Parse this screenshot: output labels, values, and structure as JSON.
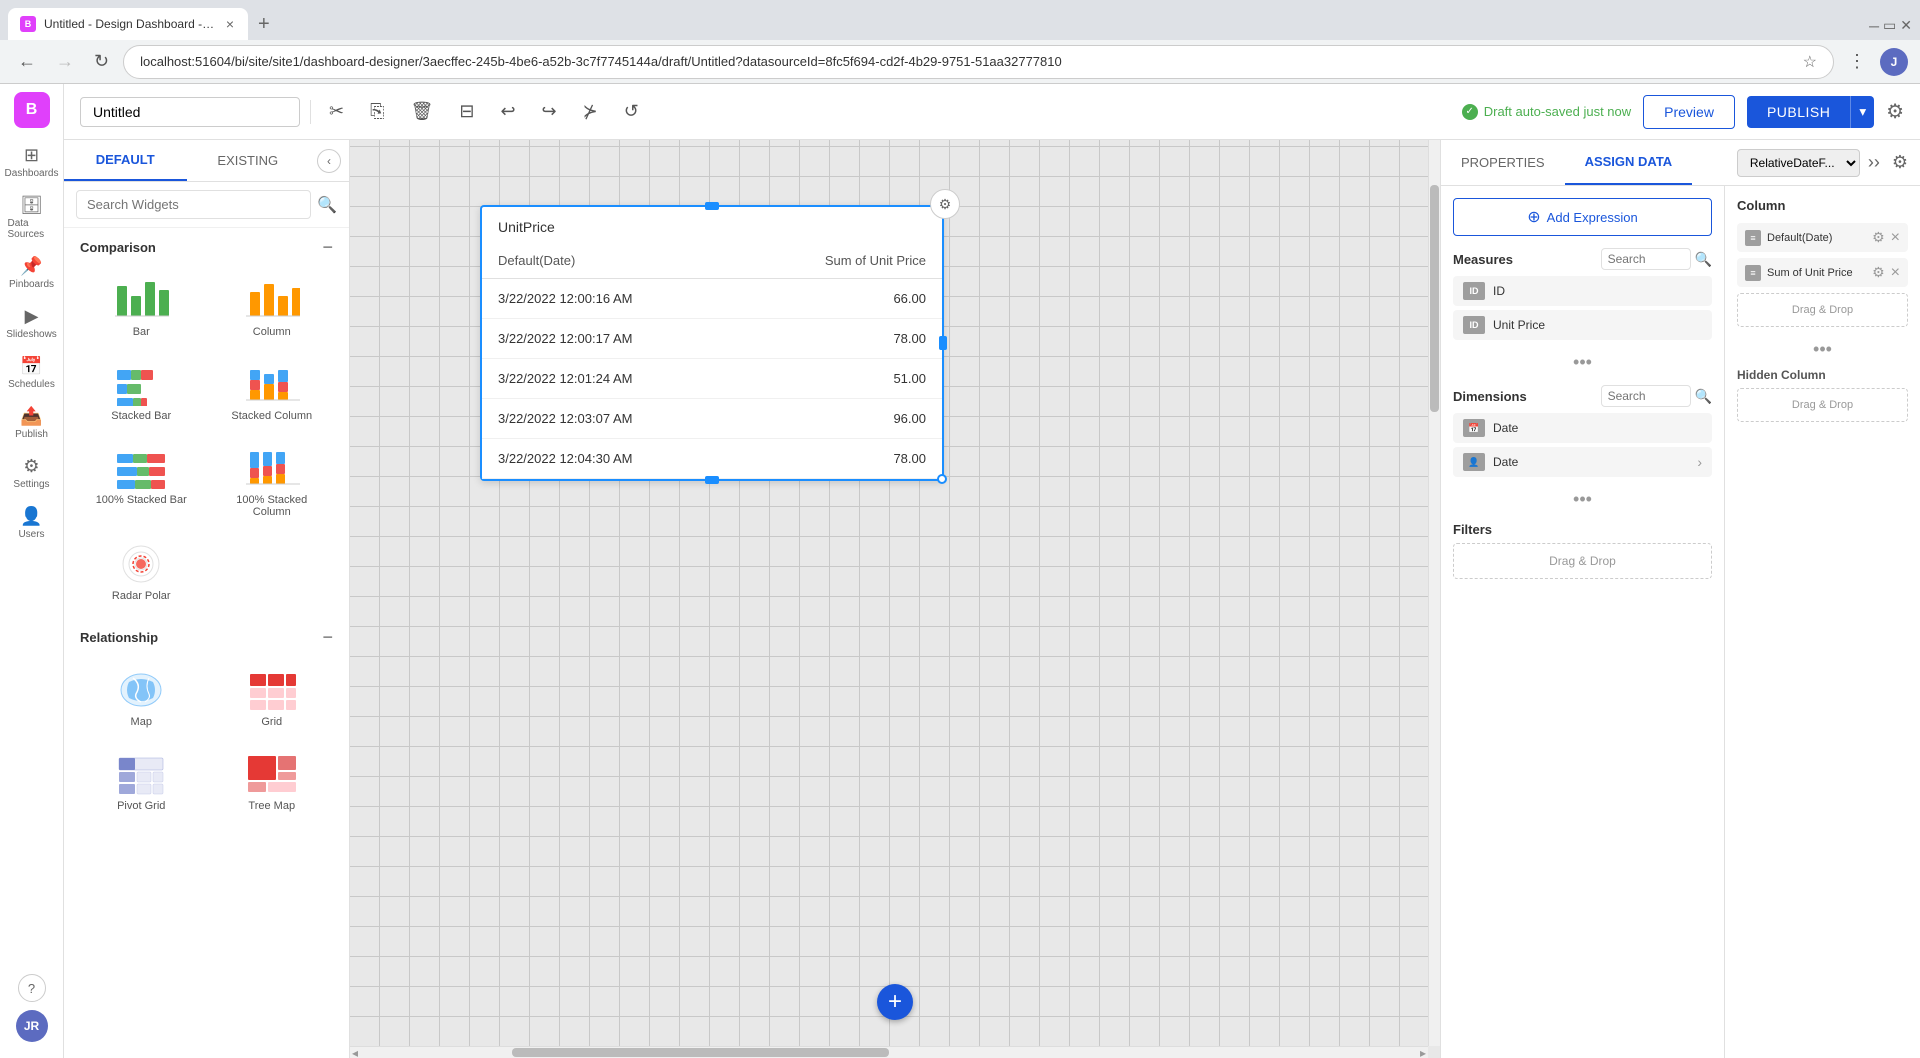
{
  "browser": {
    "tab_title": "Untitled - Design Dashboard - B...",
    "url": "localhost:51604/bi/site/site1/dashboard-designer/3aecffec-245b-4be6-a52b-3c7f7745144a/draft/Untitled?datasourceId=8fc5f694-cd2f-4b29-9751-51aa32777810",
    "new_tab_label": "+"
  },
  "toolbar": {
    "title": "Untitled",
    "auto_saved": "Draft auto-saved just now",
    "preview_label": "Preview",
    "publish_label": "PUBLISH"
  },
  "sidebar": {
    "logo": "B",
    "items": [
      {
        "id": "dashboards",
        "label": "Dashboards",
        "icon": "⊞"
      },
      {
        "id": "data-sources",
        "label": "Data Sources",
        "icon": "🗄"
      },
      {
        "id": "pinboards",
        "label": "Pinboards",
        "icon": "📌"
      },
      {
        "id": "slideshows",
        "label": "Slideshows",
        "icon": "▶"
      },
      {
        "id": "schedules",
        "label": "Schedules",
        "icon": "📅"
      },
      {
        "id": "publish",
        "label": "Publish",
        "icon": "📤"
      },
      {
        "id": "settings",
        "label": "Settings",
        "icon": "⚙"
      },
      {
        "id": "users",
        "label": "Users",
        "icon": "👤"
      }
    ],
    "user_initials": "JR",
    "help_icon": "?"
  },
  "widget_panel": {
    "tabs": [
      "DEFAULT",
      "EXISTING"
    ],
    "search_placeholder": "Search Widgets",
    "sections": {
      "comparison": {
        "title": "Comparison",
        "widgets": [
          {
            "id": "bar",
            "label": "Bar"
          },
          {
            "id": "column",
            "label": "Column"
          },
          {
            "id": "stacked-bar",
            "label": "Stacked Bar"
          },
          {
            "id": "stacked-column",
            "label": "Stacked Column"
          },
          {
            "id": "100-stacked-bar",
            "label": "100% Stacked Bar"
          },
          {
            "id": "100-stacked-column",
            "label": "100% Stacked Column"
          },
          {
            "id": "radar-polar",
            "label": "Radar Polar"
          }
        ]
      },
      "relationship": {
        "title": "Relationship",
        "widgets": [
          {
            "id": "map",
            "label": "Map"
          },
          {
            "id": "grid",
            "label": "Grid"
          },
          {
            "id": "pivot-grid",
            "label": "Pivot Grid"
          },
          {
            "id": "tree-map",
            "label": "Tree Map"
          }
        ]
      }
    }
  },
  "canvas": {
    "widget": {
      "title": "UnitPrice",
      "columns": [
        "Default(Date)",
        "Sum of Unit Price"
      ],
      "rows": [
        {
          "date": "3/22/2022 12:00:16 AM",
          "value": "66.00"
        },
        {
          "date": "3/22/2022 12:00:17 AM",
          "value": "78.00"
        },
        {
          "date": "3/22/2022 12:01:24 AM",
          "value": "51.00"
        },
        {
          "date": "3/22/2022 12:03:07 AM",
          "value": "96.00"
        },
        {
          "date": "3/22/2022 12:04:30 AM",
          "value": "78.00"
        }
      ]
    },
    "add_button": "+"
  },
  "right_panel": {
    "tabs": [
      "PROPERTIES",
      "ASSIGN DATA"
    ],
    "active_tab": "ASSIGN DATA",
    "dropdown": "RelativeDateF...",
    "add_expression": "Add Expression",
    "measures": {
      "title": "Measures",
      "search_placeholder": "Search",
      "fields": [
        "ID",
        "Unit Price"
      ],
      "assigned": [
        {
          "name": "Default(Date)",
          "icon": "≡"
        },
        {
          "name": "Sum of Unit Price",
          "icon": "≡"
        }
      ]
    },
    "dimensions": {
      "title": "Dimensions",
      "search_placeholder": "Search",
      "fields": [
        {
          "name": "Date",
          "icon": "📅"
        },
        {
          "name": "Date",
          "icon": "👤",
          "expandable": true
        }
      ]
    },
    "column_panel": {
      "title": "Column",
      "items": [
        {
          "name": "Default(Date)",
          "icon": "≡"
        },
        {
          "name": "Sum of Unit Price",
          "icon": "≡"
        }
      ],
      "drop_label": "Drag & Drop",
      "hidden_column_title": "Hidden Column",
      "hidden_drop_label": "Drag & Drop"
    },
    "filters": {
      "title": "Filters",
      "drop_label": "Drag & Drop"
    }
  }
}
